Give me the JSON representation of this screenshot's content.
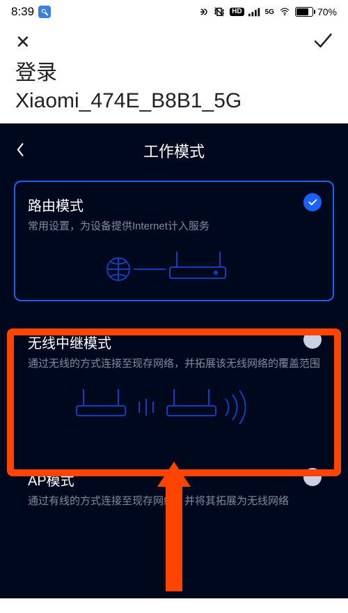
{
  "statusbar": {
    "time": "8:39",
    "battery_pct": "70",
    "network_badge": "5G",
    "hd_badge": "HD"
  },
  "browserbar": {
    "close_glyph": "✕",
    "title": "登录",
    "url": "Xiaomi_474E_B8B1_5G"
  },
  "page": {
    "title": "工作模式",
    "cards": [
      {
        "id": "router",
        "title": "路由模式",
        "desc": "常用设置，为设备提供Internet计入服务",
        "selected": true
      },
      {
        "id": "repeater",
        "title": "无线中继模式",
        "desc": "通过无线的方式连接至现存网络，并拓展该无线网络的覆盖范围",
        "selected": false,
        "highlighted": true
      },
      {
        "id": "ap",
        "title": "AP模式",
        "desc": "通过有线的方式连接至现存网络，并将其拓展为无线网络",
        "selected": false
      }
    ]
  },
  "annotation": {
    "highlight_color": "#ff4300"
  }
}
